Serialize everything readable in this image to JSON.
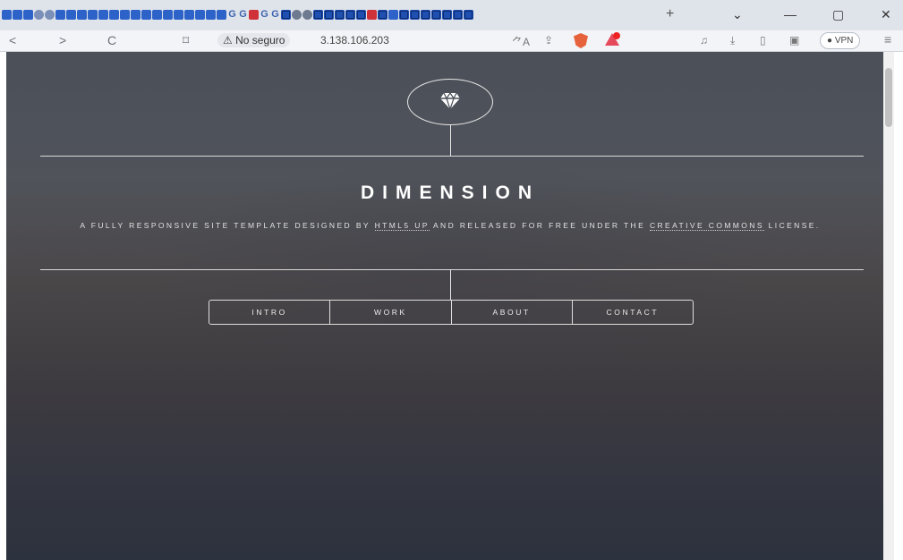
{
  "browser": {
    "tabs_count": 58,
    "new_tab_label": "+",
    "controls": {
      "dropdown": "⌄",
      "minimize": "—",
      "maximize": "▢",
      "close": "✕"
    },
    "nav": {
      "back": "<",
      "forward": ">",
      "reload": "C",
      "bookmark": "⌑"
    },
    "security_label": "⚠ No seguro",
    "url": "3.138.106.203",
    "vpn_label": "● VPN",
    "menu_icon": "≡",
    "right_icons": {
      "translate": "⺈A",
      "share": "⇪",
      "music": "♫",
      "download": "⤓",
      "sidebar": "▯",
      "wallet": "▣"
    }
  },
  "page": {
    "logo_icon": "diamond-icon",
    "title": "DIMENSION",
    "subtitle_part1": "A fully responsive site template designed by ",
    "subtitle_link1": "HTML5 UP",
    "subtitle_part2": " and released for free under the ",
    "subtitle_link2": "Creative Commons",
    "subtitle_part3": " license.",
    "menu": [
      "INTRO",
      "WORK",
      "ABOUT",
      "CONTACT"
    ]
  },
  "colors": {
    "text": "#ffffff",
    "bg_top": "#4b5059",
    "bg_bottom": "#2c323e"
  }
}
